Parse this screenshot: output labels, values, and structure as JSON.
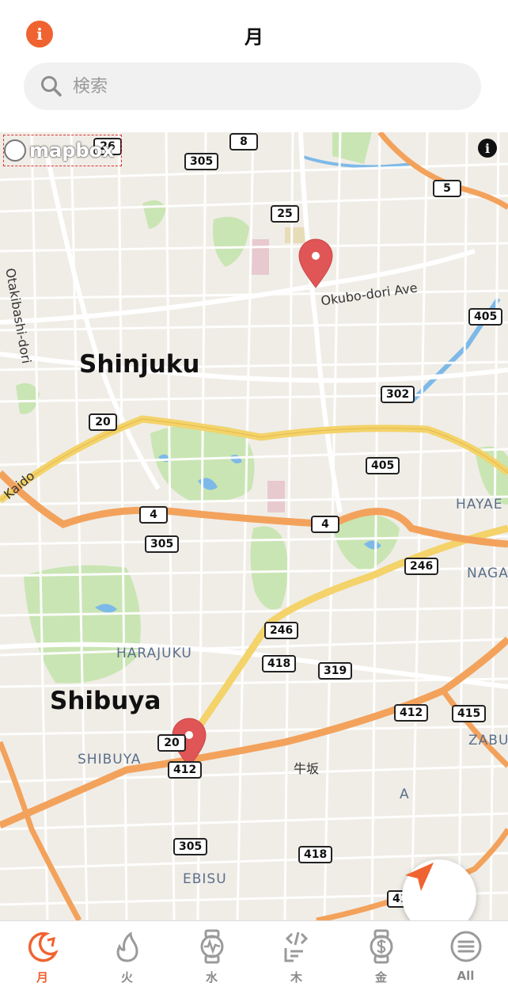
{
  "header": {
    "title": "月",
    "info_icon": "info-icon"
  },
  "search": {
    "placeholder": "検索"
  },
  "map": {
    "attribution_logo": "mapbox",
    "places": {
      "shinjuku": "Shinjuku",
      "shibuya": "Shibuya",
      "harajuku": "HARAJUKU",
      "shibuya_district": "SHIBUYA",
      "ebisu": "EBISU",
      "hayae": "HAYAE",
      "naga": "NAGA",
      "azabu": "ZABU",
      "azabu2": "A",
      "ushigome": "牛坂"
    },
    "roads": {
      "okubo": "Okubo-dori Ave",
      "otakibashi": "Otakibashi-dori",
      "kaido": "Kaido"
    },
    "shields": [
      "8",
      "305",
      "25",
      "5",
      "405",
      "302",
      "20",
      "405",
      "4",
      "4",
      "305",
      "246",
      "246",
      "418",
      "319",
      "412",
      "415",
      "412",
      "305",
      "418",
      "416",
      "20",
      "26"
    ],
    "markers": [
      "marker-north",
      "marker-south"
    ]
  },
  "colors": {
    "accent": "#ef6331",
    "marker": "#e05555"
  },
  "tabs": [
    {
      "label": "月",
      "icon": "moon-icon",
      "active": true
    },
    {
      "label": "火",
      "icon": "fire-icon",
      "active": false
    },
    {
      "label": "水",
      "icon": "watch-icon",
      "active": false
    },
    {
      "label": "木",
      "icon": "code-icon",
      "active": false
    },
    {
      "label": "金",
      "icon": "money-icon",
      "active": false
    },
    {
      "label": "All",
      "icon": "menu-icon",
      "active": false
    }
  ]
}
